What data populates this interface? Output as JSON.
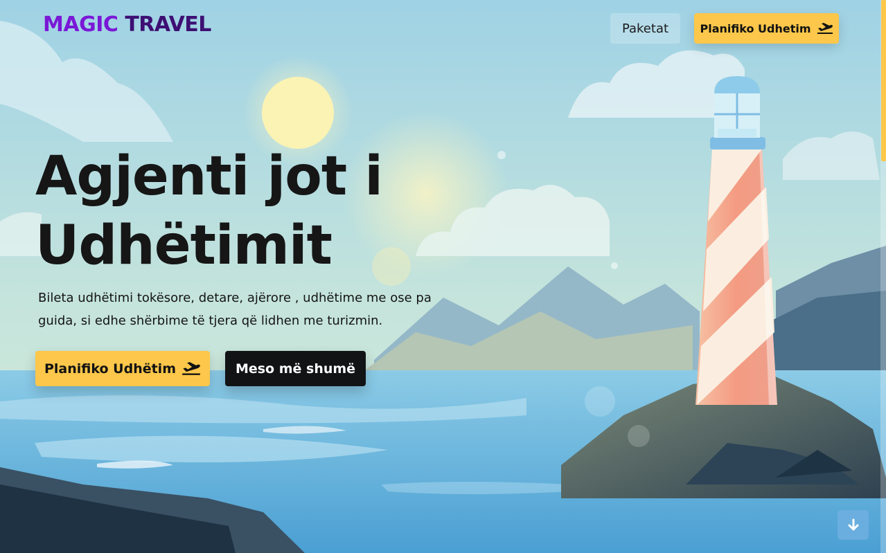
{
  "header": {
    "logo_word1": "MAGIC",
    "logo_word2": "TRAVEL",
    "nav_packages": "Paketat",
    "nav_plan": "Planifiko Udhetim"
  },
  "hero": {
    "title_line1": "Agjenti jot i",
    "title_line2": "Udhëtimit",
    "description_line1": "Bileta udhëtimi tokësore, detare, ajërore , udhëtime me ose pa",
    "description_line2": "guida, si edhe shërbime të tjera që lidhen me turizmin.",
    "plan_button": "Planifiko Udhëtim",
    "more_button": "Meso më shumë"
  },
  "icons": {
    "plane": "plane-departure-icon",
    "scroll": "arrow-down-icon"
  },
  "colors": {
    "accent_yellow": "#fcc74a",
    "logo_purple": "#7a18d6",
    "logo_dark_purple": "#3d0f73",
    "dark_button": "#111315"
  }
}
